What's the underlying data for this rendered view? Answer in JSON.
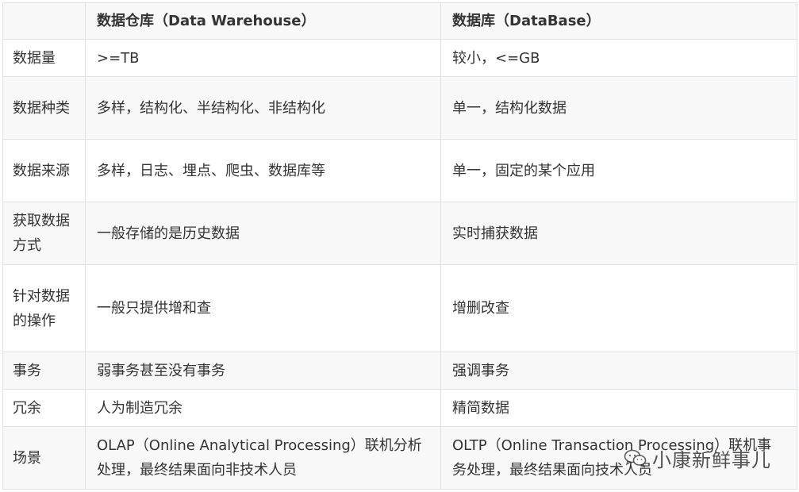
{
  "table": {
    "headers": [
      "",
      "数据仓库（Data Warehouse）",
      "数据库（DataBase）"
    ],
    "rows": [
      {
        "label": "数据量",
        "dw": ">=TB",
        "db": "较小，<=GB"
      },
      {
        "label": "数据种类",
        "dw": "多样，结构化、半结构化、非结构化",
        "db": "单一，结构化数据"
      },
      {
        "label": "数据来源",
        "dw": "多样，日志、埋点、爬虫、数据库等",
        "db": "单一，固定的某个应用"
      },
      {
        "label": "获取数据方式",
        "dw": "一般存储的是历史数据",
        "db": "实时捕获数据"
      },
      {
        "label": "针对数据的操作",
        "dw": "一般只提供增和查",
        "db": "增删改查"
      },
      {
        "label": "事务",
        "dw": "弱事务甚至没有事务",
        "db": "强调事务"
      },
      {
        "label": "冗余",
        "dw": "人为制造冗余",
        "db": "精简数据"
      },
      {
        "label": "场景",
        "dw": "OLAP（Online Analytical Processing）联机分析处理，最终结果面向非技术人员",
        "db": "OLTP（Online Transaction Processing）联机事务处理，最终结果面向技术人员"
      }
    ]
  },
  "watermark": {
    "icon": "wechat-icon",
    "text": "小康新鲜事儿"
  }
}
